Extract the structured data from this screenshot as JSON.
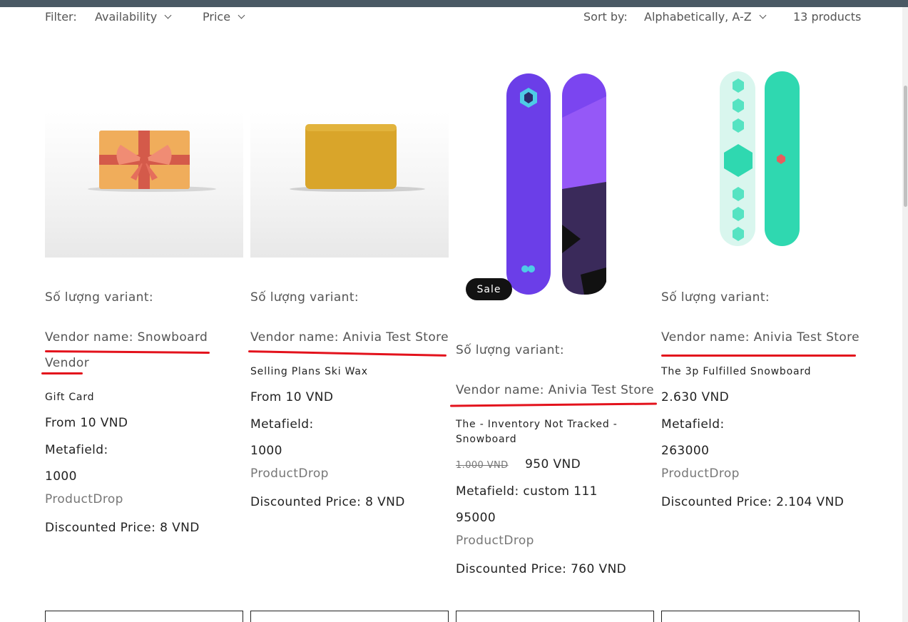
{
  "filter": {
    "label": "Filter:",
    "availability": "Availability",
    "price": "Price",
    "sort_label": "Sort by:",
    "sort_value": "Alphabetically, A-Z",
    "count": "13 products"
  },
  "badge": {
    "sale": "Sale"
  },
  "products": [
    {
      "variant": "Số lượng variant:",
      "vendor_line1": "Vendor name: Snowboard",
      "vendor_line2": "Vendor",
      "title": "Gift Card",
      "price": "From 10 VND",
      "metafield_label": "Metafield:",
      "metafield_value": "1000",
      "drop": "ProductDrop",
      "discounted": "Discounted Price: 8 VND"
    },
    {
      "variant": "Số lượng variant:",
      "vendor_line1": "Vendor name: Anivia Test Store",
      "title": "Selling Plans Ski Wax",
      "price": "From 10 VND",
      "metafield_label": "Metafield:",
      "metafield_value": "1000",
      "drop": "ProductDrop",
      "discounted": "Discounted Price: 8 VND"
    },
    {
      "variant": "Số lượng variant:",
      "vendor_line1": "Vendor name: Anivia Test Store",
      "title_line1": "The - Inventory Not Tracked -",
      "title_line2": "Snowboard",
      "price_old": "1.000 VND",
      "price": "950 VND",
      "metafield_label": "Metafield: custom 111",
      "metafield_value": "95000",
      "drop": "ProductDrop",
      "discounted": "Discounted Price: 760 VND"
    },
    {
      "variant": "Số lượng variant:",
      "vendor_line1": "Vendor name: Anivia Test Store",
      "title": "The 3p Fulfilled Snowboard",
      "price": "2.630 VND",
      "metafield_label": "Metafield:",
      "metafield_value": "263000",
      "drop": "ProductDrop",
      "discounted": "Discounted Price: 2.104 VND"
    }
  ],
  "colors": {
    "annotation_red": "#e3121c",
    "top_bar": "#4a5964",
    "purple_board": "#6b3ee8",
    "teal_board": "#2fd8b0"
  }
}
